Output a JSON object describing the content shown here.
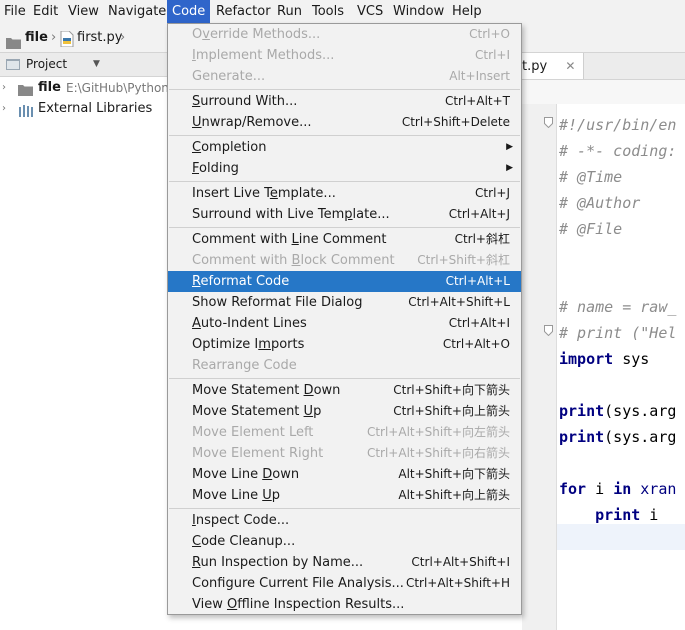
{
  "menubar": {
    "items": [
      {
        "label": "File",
        "active": false
      },
      {
        "label": "Edit",
        "active": false
      },
      {
        "label": "View",
        "active": false
      },
      {
        "label": "Navigate",
        "active": false
      },
      {
        "label": "Code",
        "active": true
      },
      {
        "label": "Refactor",
        "active": false
      },
      {
        "label": "Run",
        "active": false
      },
      {
        "label": "Tools",
        "active": false
      },
      {
        "label": "VCS",
        "active": false
      },
      {
        "label": "Window",
        "active": false
      },
      {
        "label": "Help",
        "active": false
      }
    ]
  },
  "navbar": {
    "folder_label": "file",
    "file_label": "first.py"
  },
  "project_panel": {
    "header_label": "Project",
    "tree": [
      {
        "label": "file",
        "path": "E:\\GitHub\\Python-",
        "icon": "folder-icon"
      },
      {
        "label": "External Libraries",
        "icon": "library-icon"
      }
    ]
  },
  "editor": {
    "tab_label": "t.py",
    "close_icon": "close-icon",
    "code_lines": [
      {
        "segments": [
          {
            "t": "#!/usr/bin/en",
            "c": "cm"
          }
        ]
      },
      {
        "segments": [
          {
            "t": "# -*- coding:",
            "c": "cm"
          }
        ]
      },
      {
        "segments": [
          {
            "t": "# @Time",
            "c": "cm"
          }
        ]
      },
      {
        "segments": [
          {
            "t": "# @Author",
            "c": "cm"
          }
        ]
      },
      {
        "segments": [
          {
            "t": "# @File",
            "c": "cm"
          }
        ]
      },
      {
        "segments": []
      },
      {
        "segments": []
      },
      {
        "segments": [
          {
            "t": "# name = raw_",
            "c": "cm"
          }
        ]
      },
      {
        "segments": [
          {
            "t": "# print (\"Hel",
            "c": "cm"
          }
        ]
      },
      {
        "segments": [
          {
            "t": "import",
            "c": "kw"
          },
          {
            "t": " sys",
            "c": "tx"
          }
        ]
      },
      {
        "segments": []
      },
      {
        "segments": [
          {
            "t": "print",
            "c": "kw"
          },
          {
            "t": "(sys.arg",
            "c": "tx"
          }
        ]
      },
      {
        "segments": [
          {
            "t": "print",
            "c": "kw"
          },
          {
            "t": "(sys.arg",
            "c": "tx"
          }
        ]
      },
      {
        "segments": []
      },
      {
        "segments": [
          {
            "t": "for",
            "c": "kw"
          },
          {
            "t": " i ",
            "c": "tx"
          },
          {
            "t": "in",
            "c": "kw"
          },
          {
            "t": " ",
            "c": "tx"
          },
          {
            "t": "xran",
            "c": "bi"
          }
        ]
      },
      {
        "segments": [
          {
            "t": "    ",
            "c": "tx"
          },
          {
            "t": "print",
            "c": "kw"
          },
          {
            "t": " i",
            "c": "tx"
          }
        ]
      }
    ]
  },
  "code_menu": {
    "items": [
      {
        "type": "item",
        "label": "Override Methods...",
        "shortcut": "Ctrl+O",
        "disabled": true,
        "mn": 1
      },
      {
        "type": "item",
        "label": "Implement Methods...",
        "shortcut": "Ctrl+I",
        "disabled": true,
        "mn": 0
      },
      {
        "type": "item",
        "label": "Generate...",
        "shortcut": "Alt+Insert",
        "disabled": true,
        "mn": -1
      },
      {
        "type": "sep"
      },
      {
        "type": "item",
        "label": "Surround With...",
        "shortcut": "Ctrl+Alt+T",
        "disabled": false,
        "mn": 0
      },
      {
        "type": "item",
        "label": "Unwrap/Remove...",
        "shortcut": "Ctrl+Shift+Delete",
        "disabled": false,
        "mn": 0
      },
      {
        "type": "sep"
      },
      {
        "type": "item",
        "label": "Completion",
        "shortcut": "",
        "disabled": false,
        "submenu": true,
        "mn": 0
      },
      {
        "type": "item",
        "label": "Folding",
        "shortcut": "",
        "disabled": false,
        "submenu": true,
        "mn": 0
      },
      {
        "type": "sep"
      },
      {
        "type": "item",
        "label": "Insert Live Template...",
        "shortcut": "Ctrl+J",
        "disabled": false,
        "mn": 13
      },
      {
        "type": "item",
        "label": "Surround with Live Template...",
        "shortcut": "Ctrl+Alt+J",
        "disabled": false,
        "mn": 22
      },
      {
        "type": "sep"
      },
      {
        "type": "item",
        "label": "Comment with Line Comment",
        "shortcut": "Ctrl+斜杠",
        "disabled": false,
        "mn": 13
      },
      {
        "type": "item",
        "label": "Comment with Block Comment",
        "shortcut": "Ctrl+Shift+斜杠",
        "disabled": true,
        "mn": 13
      },
      {
        "type": "item",
        "label": "Reformat Code",
        "shortcut": "Ctrl+Alt+L",
        "disabled": false,
        "selected": true,
        "mn": 0
      },
      {
        "type": "item",
        "label": "Show Reformat File Dialog",
        "shortcut": "Ctrl+Alt+Shift+L",
        "disabled": false,
        "mn": -1
      },
      {
        "type": "item",
        "label": "Auto-Indent Lines",
        "shortcut": "Ctrl+Alt+I",
        "disabled": false,
        "mn": 0
      },
      {
        "type": "item",
        "label": "Optimize Imports",
        "shortcut": "Ctrl+Alt+O",
        "disabled": false,
        "mn": 10
      },
      {
        "type": "item",
        "label": "Rearrange Code",
        "shortcut": "",
        "disabled": true,
        "mn": -1
      },
      {
        "type": "sep"
      },
      {
        "type": "item",
        "label": "Move Statement Down",
        "shortcut": "Ctrl+Shift+向下箭头",
        "disabled": false,
        "mn": 15
      },
      {
        "type": "item",
        "label": "Move Statement Up",
        "shortcut": "Ctrl+Shift+向上箭头",
        "disabled": false,
        "mn": 15
      },
      {
        "type": "item",
        "label": "Move Element Left",
        "shortcut": "Ctrl+Alt+Shift+向左箭头",
        "disabled": true,
        "mn": -1
      },
      {
        "type": "item",
        "label": "Move Element Right",
        "shortcut": "Ctrl+Alt+Shift+向右箭头",
        "disabled": true,
        "mn": -1
      },
      {
        "type": "item",
        "label": "Move Line Down",
        "shortcut": "Alt+Shift+向下箭头",
        "disabled": false,
        "mn": 10
      },
      {
        "type": "item",
        "label": "Move Line Up",
        "shortcut": "Alt+Shift+向上箭头",
        "disabled": false,
        "mn": 10
      },
      {
        "type": "sep"
      },
      {
        "type": "item",
        "label": "Inspect Code...",
        "shortcut": "",
        "disabled": false,
        "mn": 0
      },
      {
        "type": "item",
        "label": "Code Cleanup...",
        "shortcut": "",
        "disabled": false,
        "mn": 0
      },
      {
        "type": "item",
        "label": "Run Inspection by Name...",
        "shortcut": "Ctrl+Alt+Shift+I",
        "disabled": false,
        "mn": 0
      },
      {
        "type": "item",
        "label": "Configure Current File Analysis...",
        "shortcut": "Ctrl+Alt+Shift+H",
        "disabled": false,
        "mn": -1
      },
      {
        "type": "item",
        "label": "View Offline Inspection Results...",
        "shortcut": "",
        "disabled": false,
        "mn": 5
      }
    ]
  }
}
